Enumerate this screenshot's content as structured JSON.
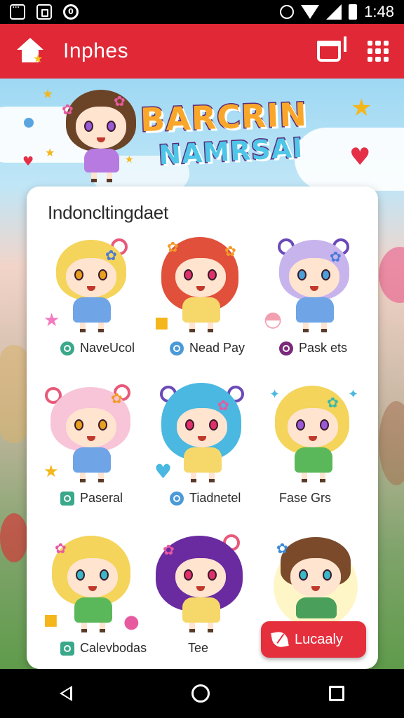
{
  "status_bar": {
    "time": "1:48"
  },
  "app_bar": {
    "title": "Inphes"
  },
  "hero": {
    "logo_line1": "BARCRIN",
    "logo_line2": "NAMRSAI"
  },
  "card": {
    "title": "Indoncltingdaet",
    "items": [
      {
        "label": "NaveUcol",
        "icon": "sticker-icon",
        "icon_color": "#3aa88a"
      },
      {
        "label": "Nead Pay",
        "icon": "pay-icon",
        "icon_color": "#4a9ad8"
      },
      {
        "label": "Pask ets",
        "icon": "pack-icon",
        "icon_color": "#7a2a7a"
      },
      {
        "label": "Paseral",
        "icon": "sticker-icon",
        "icon_color": "#3aa88a"
      },
      {
        "label": "Tiadnetel",
        "icon": "pay-icon",
        "icon_color": "#4a9ad8"
      },
      {
        "label": "Fase Grs",
        "icon": "",
        "icon_color": ""
      },
      {
        "label": "Calevbodas",
        "icon": "sticker-icon",
        "icon_color": "#3aa88a"
      },
      {
        "label": "Tee",
        "icon": "",
        "icon_color": ""
      }
    ]
  },
  "fab": {
    "label": "Lucaaly"
  },
  "colors": {
    "primary": "#e02836",
    "fab": "#e52f3d"
  }
}
